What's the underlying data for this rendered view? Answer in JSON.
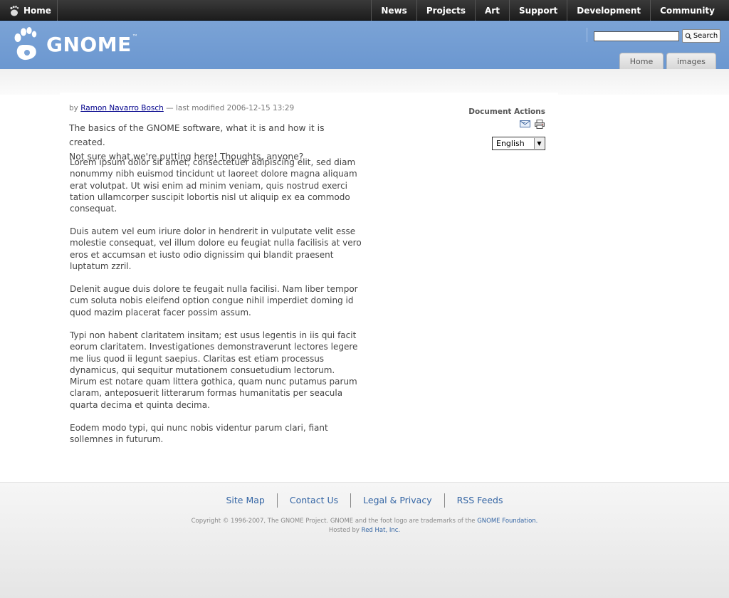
{
  "topbar": {
    "home_label": "Home",
    "nav": [
      "News",
      "Projects",
      "Art",
      "Support",
      "Development",
      "Community"
    ]
  },
  "header": {
    "logo_text": "GNOME",
    "logo_tm": "™",
    "search_placeholder": "",
    "search_button": "Search",
    "tabs": [
      "Home",
      "images"
    ]
  },
  "article": {
    "byline_prefix": "by",
    "author": "Ramon Navarro Bosch",
    "modified": "— last modified 2006-12-15 13:29",
    "description_line1": "The basics of the GNOME software, what it is and how it is created.",
    "description_line2": "Not sure what we're putting here! Thoughts, anyone?",
    "paragraphs": [
      "Lorem ipsum dolor sit amet, consectetuer adipiscing elit, sed diam nonummy nibh euismod tincidunt ut laoreet dolore magna aliquam  erat volutpat. Ut wisi enim ad minim veniam, quis nostrud exerci tation ullamcorper suscipit lobortis nisl ut aliquip ex ea commodo consequat.",
      "Duis autem vel eum iriure dolor in hendrerit in vulputate velit esse molestie consequat, vel illum dolore eu feugiat nulla facilisis at vero eros et accumsan et iusto odio dignissim qui blandit praesent luptatum zzril.",
      "Delenit augue duis dolore te feugait nulla facilisi. Nam liber tempor cum soluta nobis eleifend option congue nihil imperdiet doming id quod mazim placerat facer possim assum.",
      "Typi non habent claritatem insitam; est usus legentis in iis qui facit eorum claritatem. Investigationes demonstraverunt lectores legere me lius quod ii legunt saepius. Claritas est etiam processus dynamicus, qui sequitur mutationem consuetudium lectorum. Mirum est notare quam littera gothica, quam nunc putamus parum claram, anteposuerit litterarum formas humanitatis per seacula quarta decima et quinta decima.",
      "Eodem modo typi, qui nunc nobis videntur parum clari, fiant sollemnes in futurum."
    ]
  },
  "sidebar": {
    "title": "Document Actions",
    "icons": [
      "email-icon",
      "print-icon"
    ],
    "language": "English"
  },
  "footer": {
    "links": [
      "Site Map",
      "Contact Us",
      "Legal & Privacy",
      "RSS Feeds"
    ],
    "copyright_text": "Copyright © 1996-2007, The GNOME Project. GNOME and the foot logo are trademarks of the",
    "foundation_link": "GNOME Foundation.",
    "hosted_prefix": "Hosted by",
    "host_link": "Red Hat, Inc."
  },
  "colors": {
    "header_blue": "#7ba3d6",
    "topbar_black": "#2a2a2a",
    "link_blue": "#3465a4"
  }
}
